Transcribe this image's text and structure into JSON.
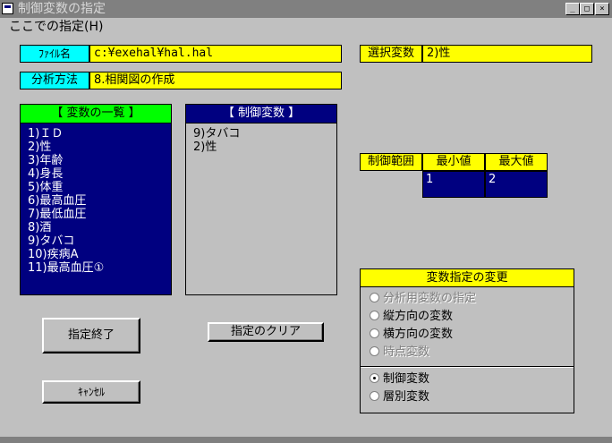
{
  "window": {
    "title": "制御変数の指定",
    "buttons": {
      "minimize": "_",
      "maximize": "□",
      "close": "×"
    }
  },
  "menu": {
    "item": "ここでの指定(H)"
  },
  "file": {
    "label": "ﾌｧｲﾙ名",
    "value": "c:¥exehal¥hal.hal"
  },
  "method": {
    "label": "分析方法",
    "value": "8.相関図の作成"
  },
  "selected_var": {
    "label": "選択変数",
    "value": "2)性"
  },
  "variables": {
    "header": "【 変数の一覧 】",
    "items": [
      "1)ＩＤ",
      "2)性",
      "3)年齢",
      "4)身長",
      "5)体重",
      "6)最高血圧",
      "7)最低血圧",
      "8)酒",
      "9)タバコ",
      "10)疾病A",
      "11)最高血圧①"
    ]
  },
  "control_vars": {
    "header": "【 制御変数 】",
    "items": [
      "9)タバコ",
      "2)性"
    ]
  },
  "range": {
    "label": "制御範囲",
    "min_header": "最小値",
    "max_header": "最大値",
    "min_value": "1",
    "max_value": "2"
  },
  "buttons": {
    "finish": "指定終了",
    "clear": "指定のクリア",
    "cancel": "ｷｬﾝｾﾙ"
  },
  "change_panel": {
    "title": "変数指定の変更",
    "options_top": [
      {
        "label": "分析用変数の指定",
        "disabled": true
      },
      {
        "label": "縦方向の変数",
        "disabled": false
      },
      {
        "label": "横方向の変数",
        "disabled": false
      },
      {
        "label": "時点変数",
        "disabled": true
      }
    ],
    "options_bottom": [
      {
        "label": "制御変数",
        "checked": true
      },
      {
        "label": "層別変数",
        "checked": false
      }
    ]
  },
  "colors": {
    "navy": "#000080",
    "yellow": "#ffff00",
    "cyan": "#00ffff",
    "green": "#00ff00",
    "face": "#c0c0c0"
  }
}
